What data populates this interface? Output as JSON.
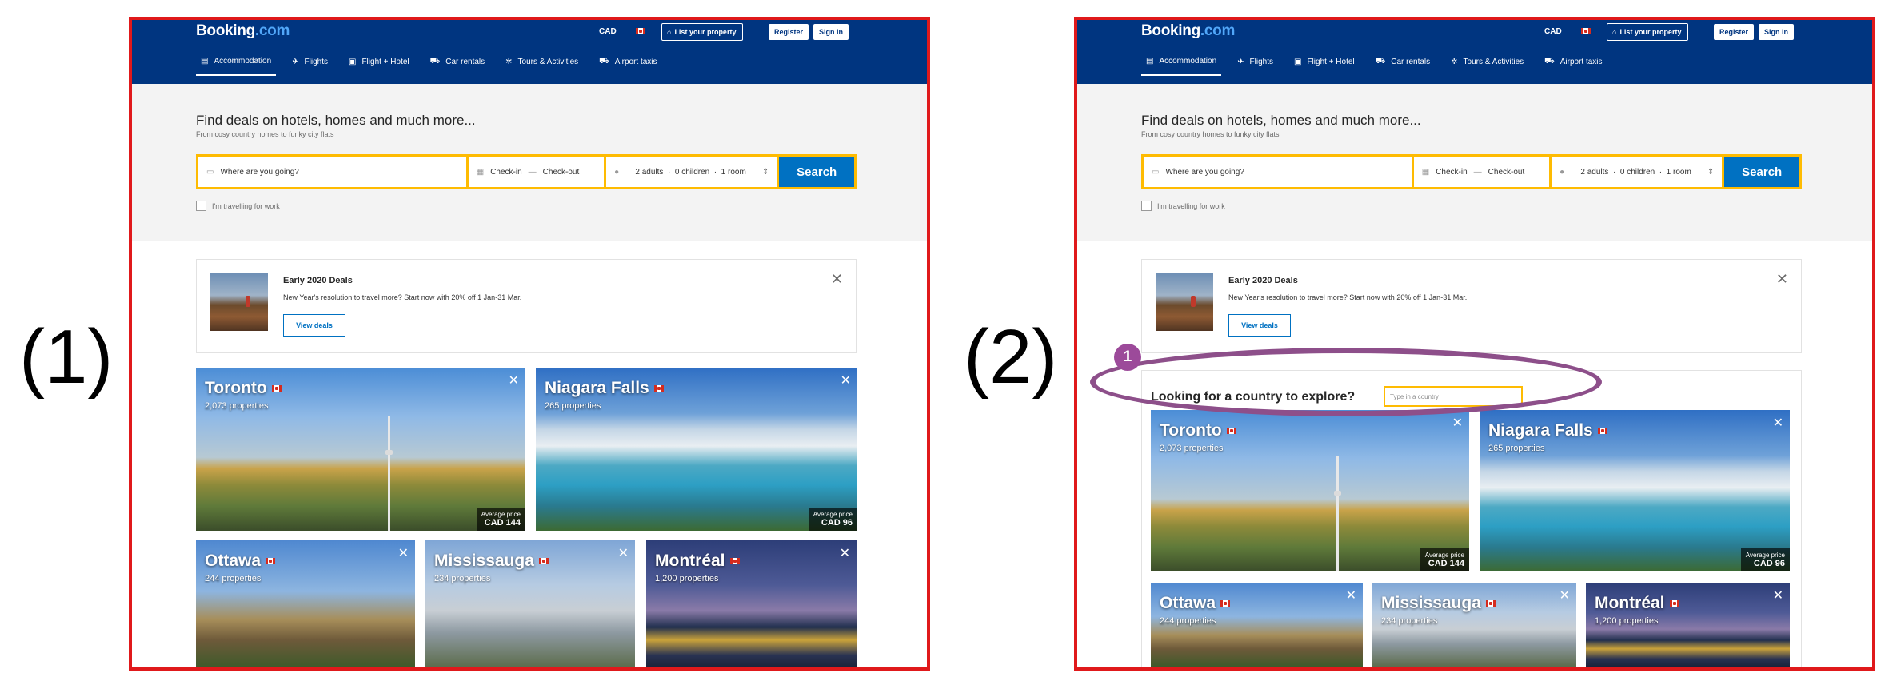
{
  "panels": [
    {
      "label": "(1)"
    },
    {
      "label": "(2)"
    }
  ],
  "header": {
    "logo_main": "Booking",
    "logo_suffix": ".com",
    "currency": "CAD",
    "list_property": "List your property",
    "register": "Register",
    "sign_in": "Sign in"
  },
  "nav": [
    {
      "label": "Accommodation",
      "icon": "bed-icon",
      "active": true
    },
    {
      "label": "Flights",
      "icon": "plane-icon",
      "active": false
    },
    {
      "label": "Flight + Hotel",
      "icon": "suitcase-icon",
      "active": false
    },
    {
      "label": "Car rentals",
      "icon": "car-icon",
      "active": false
    },
    {
      "label": "Tours & Activities",
      "icon": "activity-icon",
      "active": false
    },
    {
      "label": "Airport taxis",
      "icon": "taxi-icon",
      "active": false
    }
  ],
  "hero": {
    "title": "Find deals on hotels, homes and much more...",
    "subtitle": "From cosy country homes to funky city flats"
  },
  "search": {
    "destination_placeholder": "Where are you going?",
    "check_in": "Check-in",
    "dash": "—",
    "check_out": "Check-out",
    "guests": "2 adults  ·  0 children  ·  1 room",
    "search_button": "Search",
    "work_label": "I'm travelling for work"
  },
  "deal": {
    "title": "Early 2020 Deals",
    "text": "New Year's resolution to travel more? Start now with 20% off 1 Jan-31 Mar.",
    "button": "View deals"
  },
  "explore": {
    "badge": "1",
    "label": "Looking for a country to explore?",
    "placeholder": "Type in a country"
  },
  "cities": [
    {
      "name": "Toronto",
      "properties": "2,073 properties",
      "price_label": "Average price",
      "price": "CAD 144"
    },
    {
      "name": "Niagara Falls",
      "properties": "265 properties",
      "price_label": "Average price",
      "price": "CAD 96"
    },
    {
      "name": "Ottawa",
      "properties": "244 properties"
    },
    {
      "name": "Mississauga",
      "properties": "234 properties"
    },
    {
      "name": "Montréal",
      "properties": "1,200 properties"
    }
  ],
  "colors": {
    "header_blue": "#003580",
    "search_yellow": "#febb02",
    "cta_blue": "#0071c2",
    "frame_red": "#e0191b",
    "annotation_purple": "#8d4f8a"
  }
}
